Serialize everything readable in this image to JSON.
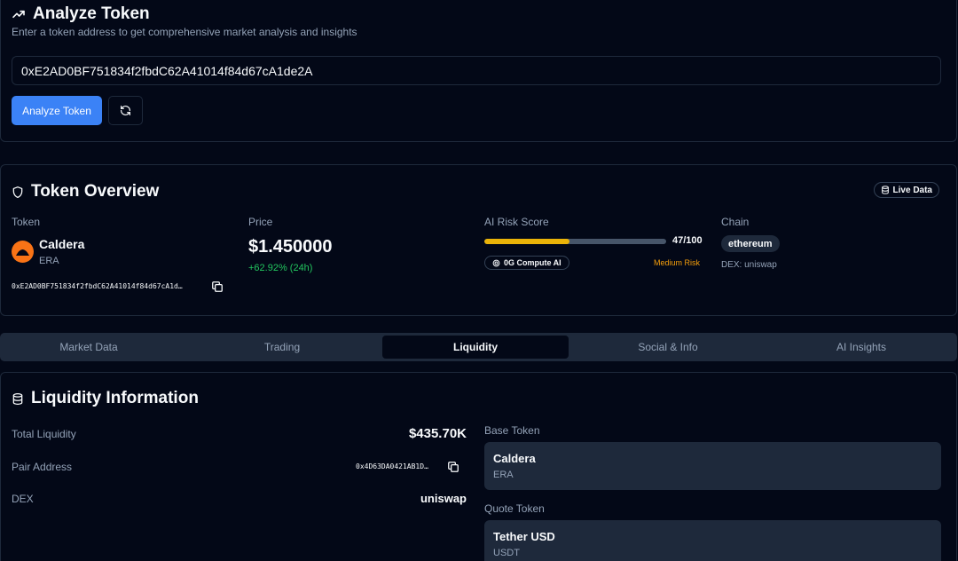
{
  "analyze": {
    "title": "Analyze Token",
    "subtitle": "Enter a token address to get comprehensive market analysis and insights",
    "address_value": "0xE2AD0BF751834f2fbdC62A41014f84d67cA1de2A",
    "analyze_button": "Analyze Token",
    "icons": {
      "title": "trending-up-icon",
      "refresh": "refresh-icon"
    }
  },
  "overview": {
    "title": "Token Overview",
    "live_badge": "Live Data",
    "token_label": "Token",
    "token_name": "Caldera",
    "token_symbol": "ERA",
    "token_address": "0xE2AD0BF751834f2fbdC62A41014f84d67cA1d…",
    "price_label": "Price",
    "price": "$1.450000",
    "price_change": "+62.92% (24h)",
    "risk_label": "AI Risk Score",
    "risk_score": "47/100",
    "risk_fraction": 0.47,
    "ai_badge": "0G Compute AI",
    "risk_level": "Medium Risk",
    "chain_label": "Chain",
    "chain": "ethereum",
    "dex_line": "DEX: uniswap",
    "colors": {
      "logo": "#f97316",
      "risk_fill": "#eab308",
      "positive": "#22c55e",
      "risk_level": "#f59e0b"
    }
  },
  "tabs": [
    {
      "label": "Market Data",
      "active": false
    },
    {
      "label": "Trading",
      "active": false
    },
    {
      "label": "Liquidity",
      "active": true
    },
    {
      "label": "Social & Info",
      "active": false
    },
    {
      "label": "AI Insights",
      "active": false
    }
  ],
  "liquidity": {
    "title": "Liquidity Information",
    "total_label": "Total Liquidity",
    "total_value": "$435.70K",
    "pair_label": "Pair Address",
    "pair_value": "0x4D63DA0421AB1D…",
    "dex_label": "DEX",
    "dex_value": "uniswap",
    "base_label": "Base Token",
    "base_name": "Caldera",
    "base_symbol": "ERA",
    "quote_label": "Quote Token",
    "quote_name": "Tether USD",
    "quote_symbol": "USDT"
  },
  "accent": "#3b82f6"
}
